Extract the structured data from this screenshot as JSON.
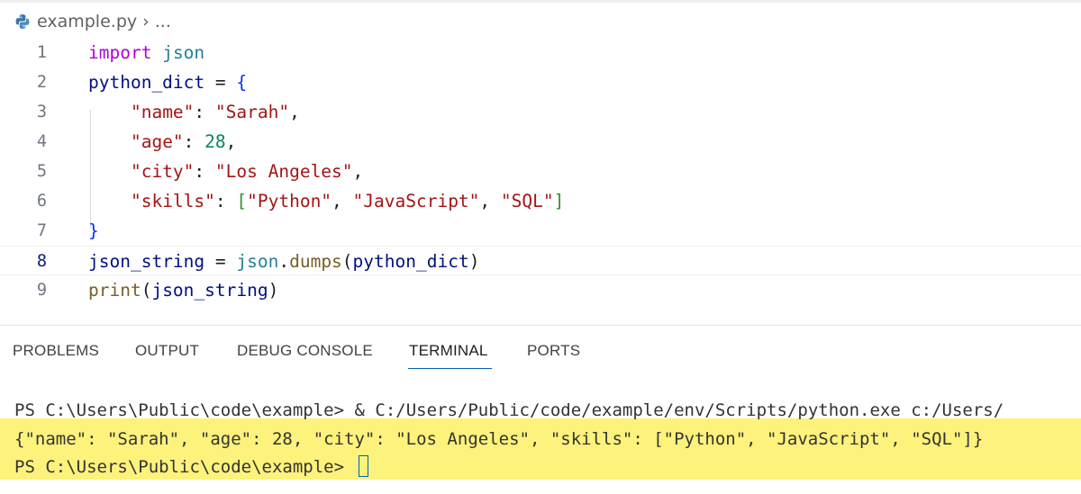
{
  "breadcrumb": {
    "filename": "example.py",
    "separator": "›",
    "ellipsis": "..."
  },
  "editor": {
    "line_numbers": [
      "1",
      "2",
      "3",
      "4",
      "5",
      "6",
      "7",
      "8",
      "9"
    ],
    "current_line": "8",
    "lines": {
      "l1": [
        "import",
        " ",
        "json"
      ],
      "l2": [
        "python_dict",
        " = ",
        "{"
      ],
      "l3": [
        "    ",
        "\"name\"",
        ": ",
        "\"Sarah\"",
        ","
      ],
      "l4": [
        "    ",
        "\"age\"",
        ": ",
        "28",
        ","
      ],
      "l5": [
        "    ",
        "\"city\"",
        ": ",
        "\"Los Angeles\"",
        ","
      ],
      "l6": [
        "    ",
        "\"skills\"",
        ": ",
        "[",
        "\"Python\"",
        ", ",
        "\"JavaScript\"",
        ", ",
        "\"SQL\"",
        "]"
      ],
      "l7": [
        "}"
      ],
      "l8": [
        "json_string",
        " = ",
        "json",
        ".",
        "dumps",
        "(",
        "python_dict",
        ")"
      ],
      "l9": [
        "print",
        "(",
        "json_string",
        ")"
      ]
    }
  },
  "panel": {
    "tabs": [
      "PROBLEMS",
      "OUTPUT",
      "DEBUG CONSOLE",
      "TERMINAL",
      "PORTS"
    ],
    "active_tab": "TERMINAL"
  },
  "terminal": {
    "line1_prompt": "PS C:\\Users\\Public\\code\\example> ",
    "line1_cmd": "& C:/Users/Public/code/example/env/Scripts/python.exe c:/Users/",
    "line2_output": "{\"name\": \"Sarah\", \"age\": 28, \"city\": \"Los Angeles\", \"skills\": [\"Python\", \"JavaScript\", \"SQL\"]}",
    "line3_prompt": "PS C:\\Users\\Public\\code\\example> "
  },
  "colors": {
    "keyword": "#af00db",
    "string": "#a31515",
    "number": "#098658",
    "highlight": "#fdf27b",
    "accent": "#005fb8"
  }
}
